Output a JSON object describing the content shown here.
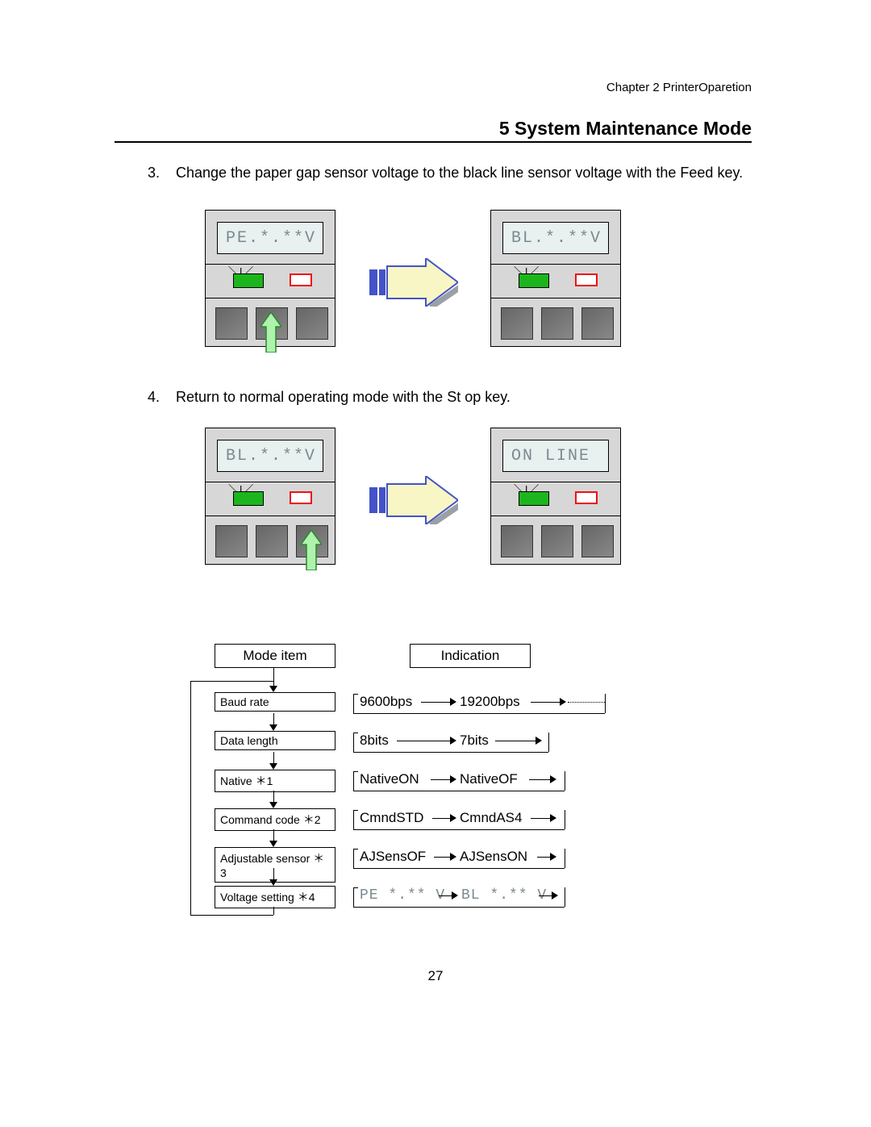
{
  "header": {
    "chapter": "Chapter 2    PrinterOparetion",
    "section": "5   System Maintenance Mode",
    "page_number": "27"
  },
  "steps": {
    "s3_num": "3.",
    "s3_text": "Change the paper gap sensor voltage to the black line sensor voltage with the Feed key.",
    "s4_num": "4.",
    "s4_text": "Return to normal operating mode with the St op key."
  },
  "panels": {
    "p1": "PE.*.**V",
    "p2": "BL.*.**V",
    "p3": "BL.*.**V",
    "p4": "ON LINE"
  },
  "flow": {
    "mode_item_label": "Mode  item",
    "indication_label": "Indication",
    "mode_items": {
      "baud": "Baud  rate",
      "datalen": "Data  length",
      "native": "Native ＊1",
      "cmd": "Command code ＊2",
      "adj": "Adjustable sensor ＊3",
      "volt": "Voltage  setting ＊4"
    },
    "indications": {
      "baud_a": "9600bps",
      "baud_b": "19200bps",
      "data_a": "8bits",
      "data_b": "7bits",
      "native_a": "NativeON",
      "native_b": "NativeOF",
      "cmd_a": "CmndSTD",
      "cmd_b": "CmndAS4",
      "adj_a": "AJSensOF",
      "adj_b": "AJSensON",
      "volt_a": "PE *.** V",
      "volt_b": "BL *.** V"
    }
  }
}
